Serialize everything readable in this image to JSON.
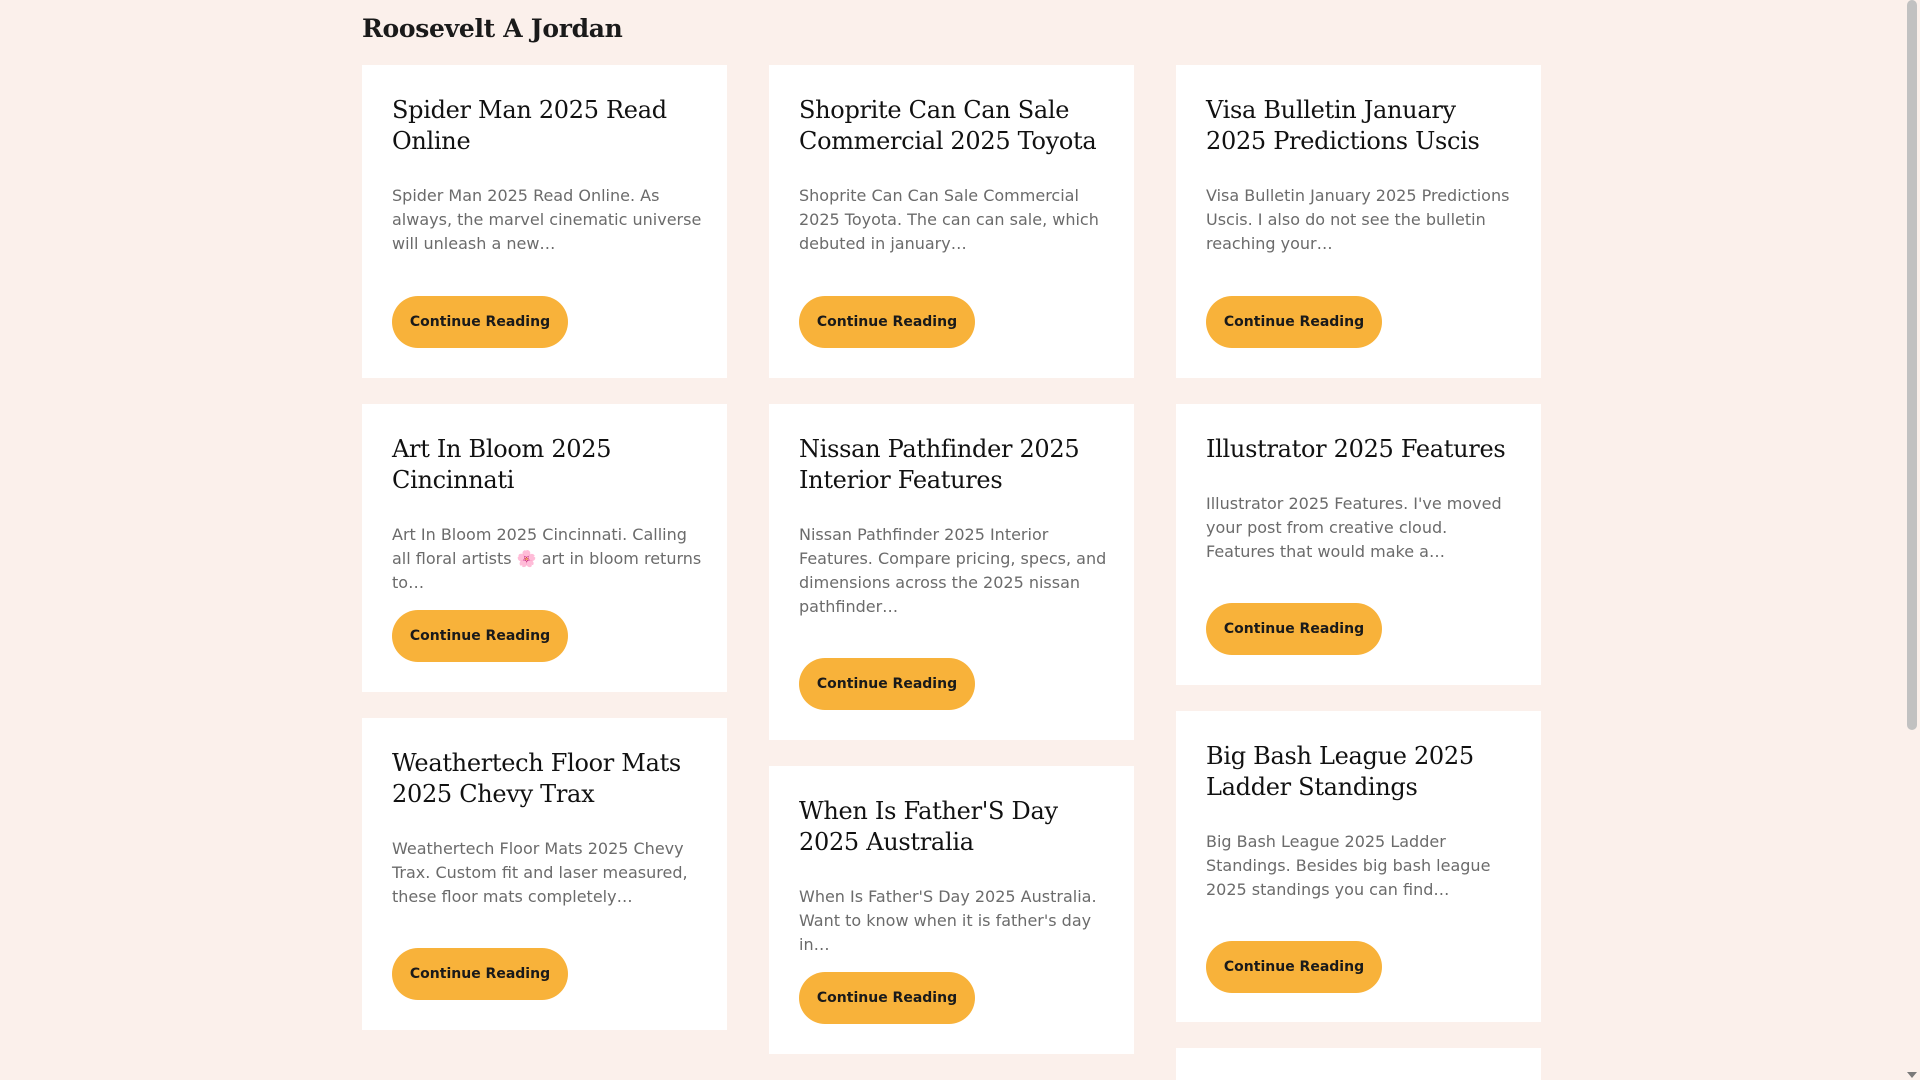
{
  "site": {
    "title": "Roosevelt A Jordan"
  },
  "cta_label": "Continue Reading",
  "colors": {
    "page_background": "#fbf0eb",
    "card_background": "#ffffff",
    "button_background": "#f8b23a"
  },
  "posts": [
    {
      "title": "Spider Man 2025 Read Online",
      "excerpt": "Spider Man 2025 Read Online. As always, the marvel cinematic universe will unleash a new…",
      "button": "Continue Reading"
    },
    {
      "title": "Shoprite Can Can Sale Commercial 2025 Toyota",
      "excerpt": "Shoprite Can Can Sale Commercial 2025 Toyota. The can can sale, which debuted in january…",
      "button": "Continue Reading"
    },
    {
      "title": "Visa Bulletin January 2025 Predictions Uscis",
      "excerpt": "Visa Bulletin January 2025 Predictions Uscis. I also do not see the bulletin reaching your…",
      "button": "Continue Reading"
    },
    {
      "title": "Art In Bloom 2025 Cincinnati",
      "excerpt": "Art In Bloom 2025 Cincinnati. Calling all floral artists 🌸 art in bloom returns to…",
      "button": "Continue Reading"
    },
    {
      "title": "Nissan Pathfinder 2025 Interior Features",
      "excerpt": "Nissan Pathfinder 2025 Interior Features. Compare pricing, specs, and dimensions across the 2025 nissan pathfinder…",
      "button": "Continue Reading"
    },
    {
      "title": "Illustrator 2025 Features",
      "excerpt": "Illustrator 2025 Features. I've moved your post from creative cloud. Features that would make a…",
      "button": "Continue Reading"
    },
    {
      "title": "Weathertech Floor Mats 2025 Chevy Trax",
      "excerpt": "Weathertech Floor Mats 2025 Chevy Trax. Custom fit and laser measured, these floor mats completely…",
      "button": "Continue Reading"
    },
    {
      "title": "When Is Father'S Day 2025 Australia",
      "excerpt": "When Is Father'S Day 2025 Australia. Want to know when it is father's day in…",
      "button": "Continue Reading"
    },
    {
      "title": "Big Bash League 2025 Ladder Standings",
      "excerpt": "Big Bash League 2025 Ladder Standings. Besides big bash league 2025 standings you can find…",
      "button": "Continue Reading"
    }
  ]
}
